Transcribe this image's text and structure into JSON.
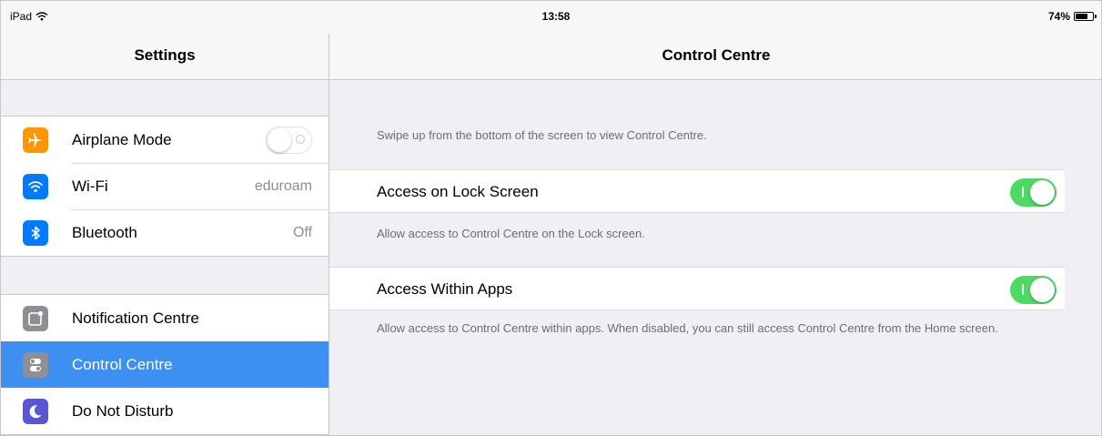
{
  "status_bar": {
    "device": "iPad",
    "time": "13:58",
    "battery": "74%",
    "battery_level": 0.74
  },
  "sidebar": {
    "title": "Settings",
    "groups": [
      {
        "items": [
          {
            "label": "Airplane Mode",
            "icon": "airplane-icon",
            "color": "#ff9500",
            "toggle": false
          },
          {
            "label": "Wi-Fi",
            "icon": "wifi-icon",
            "color": "#007aff",
            "value": "eduroam"
          },
          {
            "label": "Bluetooth",
            "icon": "bluetooth-icon",
            "color": "#007aff",
            "value": "Off"
          }
        ]
      },
      {
        "items": [
          {
            "label": "Notification Centre",
            "icon": "notification-centre-icon",
            "color": "#8e8e93"
          },
          {
            "label": "Control Centre",
            "icon": "control-centre-icon",
            "color": "#8e8e93",
            "selected": true
          },
          {
            "label": "Do Not Disturb",
            "icon": "moon-icon",
            "color": "#5856d6"
          }
        ]
      }
    ]
  },
  "detail": {
    "title": "Control Centre",
    "intro": "Swipe up from the bottom of the screen to view Control Centre.",
    "settings": [
      {
        "label": "Access on Lock Screen",
        "enabled": true,
        "footer": "Allow access to Control Centre on the Lock screen."
      },
      {
        "label": "Access Within Apps",
        "enabled": true,
        "footer": "Allow access to Control Centre within apps. When disabled, you can still access Control Centre from the Home screen."
      }
    ]
  },
  "colors": {
    "selection": "#3d8ff2",
    "toggle_on": "#4cd964",
    "background": "#efeff4"
  }
}
